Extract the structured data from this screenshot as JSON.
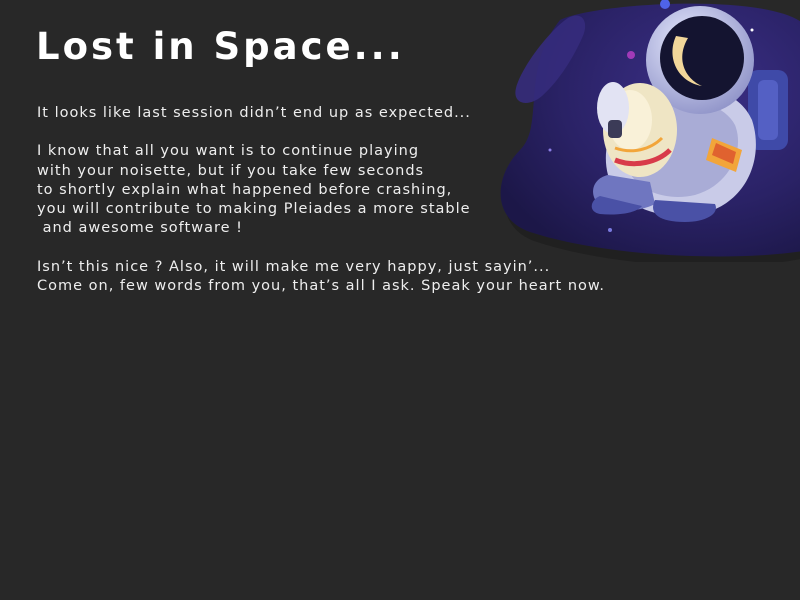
{
  "title": "Lost in Space...",
  "message": {
    "intro": "It looks like last session didn’t end up as expected...",
    "paragraph1": [
      "I know that all you want is to continue playing",
      "with your noisette, but if you take few seconds",
      "to shortly explain what happened before crashing,",
      "you will contribute to making Pleiades a more stable",
      " and awesome software !"
    ],
    "paragraph2": [
      "Isn’t this nice ? Also, it will make me very happy, just sayin’...",
      "Come on, few words from you, that’s all I ask. Speak your heart now."
    ]
  },
  "illustration": {
    "icon": "astronaut-illustration",
    "blob_color": "#2b2468",
    "accent_color": "#f2a53a"
  }
}
